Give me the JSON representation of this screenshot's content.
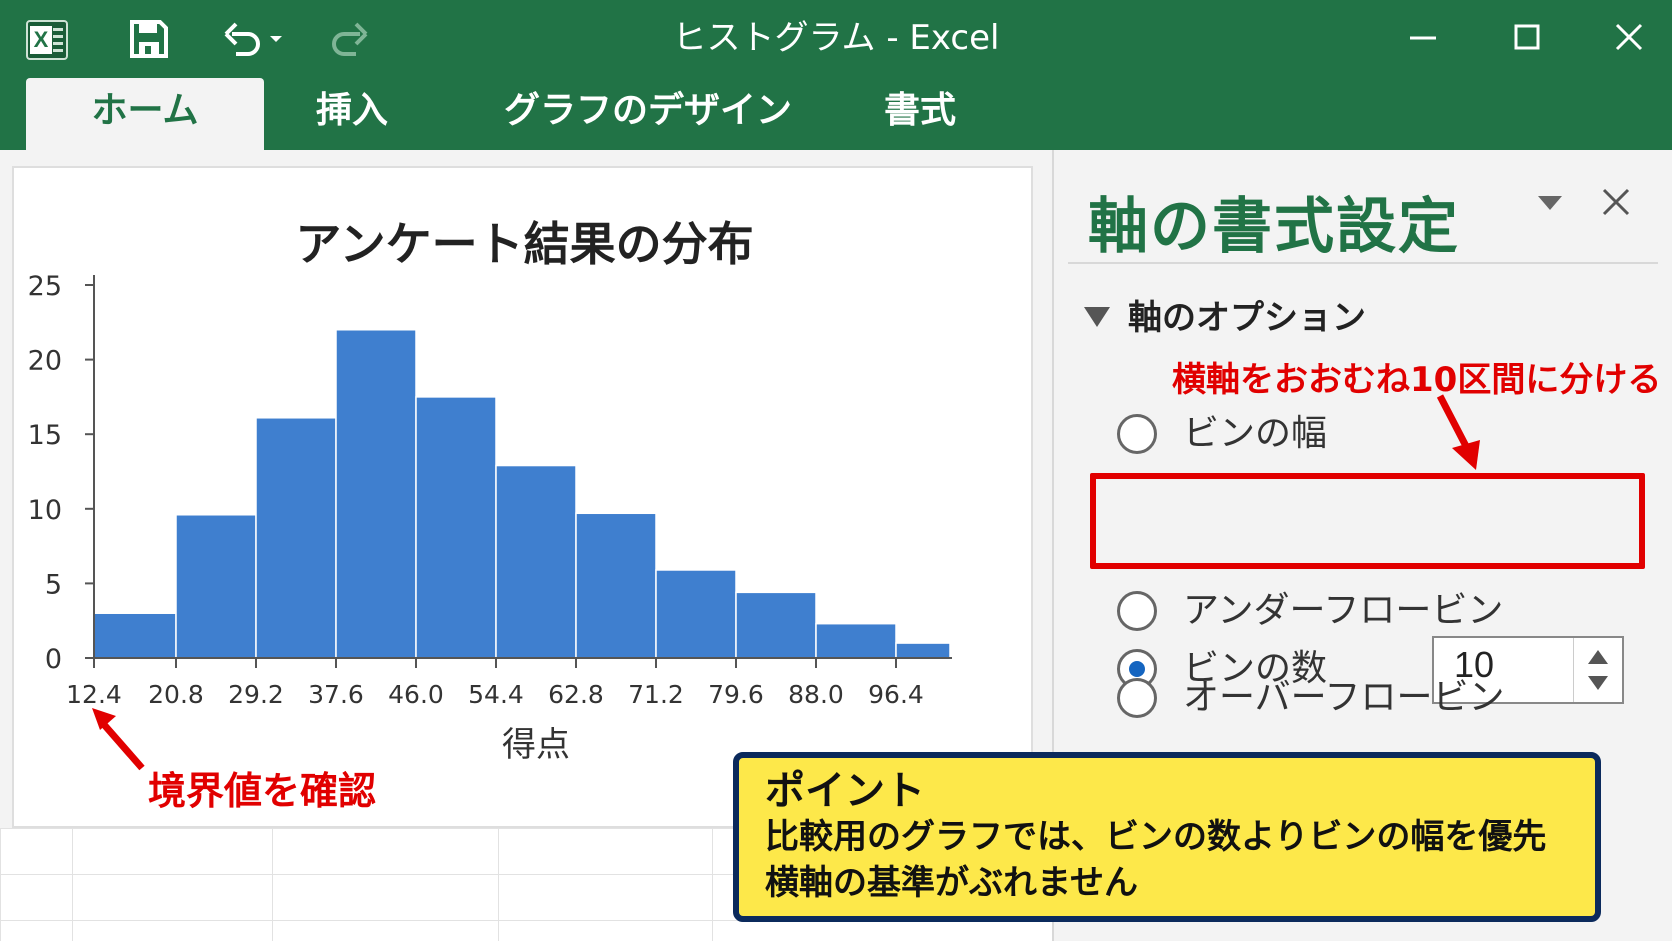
{
  "window": {
    "title": "ヒストグラム - Excel",
    "icons": [
      "excel-logo-icon",
      "save-icon",
      "undo-icon",
      "redo-icon",
      "minimize-icon",
      "maximize-icon",
      "close-icon"
    ]
  },
  "ribbon": {
    "tabs": [
      {
        "label": "ホーム",
        "active": true
      },
      {
        "label": "挿入",
        "active": false
      },
      {
        "label": "グラフのデザイン",
        "active": false
      },
      {
        "label": "書式",
        "active": false
      }
    ]
  },
  "chart_data": {
    "type": "bar",
    "title": "アンケート結果の分布",
    "xlabel": "得点",
    "ylabel": "",
    "x_ticks": [
      "12.4",
      "20.8",
      "29.2",
      "37.6",
      "46.0",
      "54.4",
      "62.8",
      "71.2",
      "79.6",
      "88.0",
      "96.4"
    ],
    "values": [
      3,
      9.6,
      16.1,
      22,
      17.5,
      12.9,
      9.7,
      5.9,
      4.4,
      2.3,
      1
    ],
    "y_ticks": [
      "0",
      "5",
      "10",
      "15",
      "20",
      "25"
    ],
    "ylim": [
      0,
      25
    ],
    "bar_color": "#3f7fcf",
    "grid": false
  },
  "annotations": {
    "boundary_note": "境界値を確認",
    "bin_note": "横軸をおおむね10区間に分ける",
    "red_color": "#e10000"
  },
  "pane": {
    "title": "軸の書式設定",
    "section": "軸のオプション",
    "options": [
      {
        "label": "ビンの幅",
        "selected": false
      },
      {
        "label": "ビンの数",
        "selected": true
      },
      {
        "label": "アンダーフロービン",
        "selected": false
      },
      {
        "label": "オーバーフロービン",
        "selected": false
      }
    ],
    "bin_count_value": "10"
  },
  "callout": {
    "heading": "ポイント",
    "line1": "比較用のグラフでは、ビンの数よりビンの幅を優先",
    "line2": "横軸の基準がぶれません"
  },
  "colors": {
    "excel_green": "#217346",
    "callout_fill": "#fde84a",
    "callout_border": "#0b2a5c"
  }
}
